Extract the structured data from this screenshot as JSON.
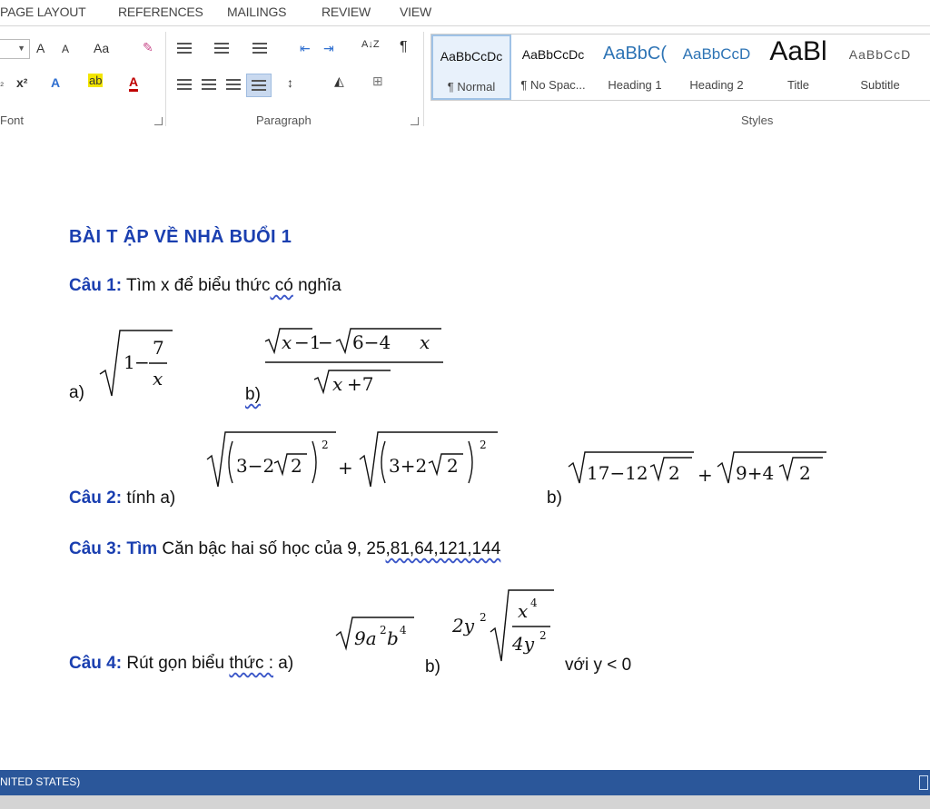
{
  "ribbon": {
    "tabs": [
      "PAGE LAYOUT",
      "REFERENCES",
      "MAILINGS",
      "REVIEW",
      "VIEW"
    ],
    "groups": {
      "font": "Font",
      "paragraph": "Paragraph",
      "styles": "Styles"
    },
    "font_buttons": {
      "grow": "A",
      "shrink": "A",
      "case": "Aa",
      "superscript": "x²",
      "text_effect": "A",
      "highlight": "ab",
      "font_color": "A"
    },
    "paragraph_buttons": {
      "sort": "A↓Z",
      "pilcrow": "¶"
    },
    "styles": [
      {
        "preview": "AaBbCcDc",
        "name": "¶ Normal"
      },
      {
        "preview": "AaBbCcDc",
        "name": "¶ No Spac..."
      },
      {
        "preview": "AaBbC(",
        "name": "Heading 1"
      },
      {
        "preview": "AaBbCcD",
        "name": "Heading 2"
      },
      {
        "preview": "AaBl",
        "name": "Title"
      },
      {
        "preview": "AaBbCcD",
        "name": "Subtitle"
      }
    ]
  },
  "document": {
    "heading": "BÀI T ẬP VỀ NHÀ BUỔI 1",
    "q1": {
      "label": "Câu 1:",
      "text_before": " Tìm x để biểu thức",
      "text_squiggle": " có",
      "text_after": " nghĩa",
      "a": "a)",
      "b": "b)"
    },
    "q2": {
      "label": "Câu 2:",
      "text": " tính a)",
      "b": "b)"
    },
    "q3": {
      "label": "Câu 3: Tìm",
      "text": " Căn bậc hai số học của 9, 25",
      "text_squiggle": ",81,64,121,144"
    },
    "q4": {
      "label": "Câu 4:",
      "text_before": " Rút gọn biểu ",
      "text_squiggle": "thức :",
      "text_after": " a)",
      "b": "b)",
      "condition": "với y < 0"
    }
  },
  "math": {
    "q1a": {
      "one": "1",
      "minus": "−",
      "num": "7",
      "den": "x"
    },
    "q1b": {
      "num": "√x−1 − √6−4x",
      "den": "√x+7"
    },
    "q2a": "√(3−2√2)² + √(3+2√2)²",
    "q2b": "√17−12√2 + √9+4√2",
    "q4a": "√9a²b⁴",
    "q4b": "2y²√(x⁴/4y²)"
  },
  "statusbar": {
    "language": "NITED STATES)"
  },
  "colors": {
    "heading": "#1a3fb0",
    "statusbar": "#2b579a"
  }
}
